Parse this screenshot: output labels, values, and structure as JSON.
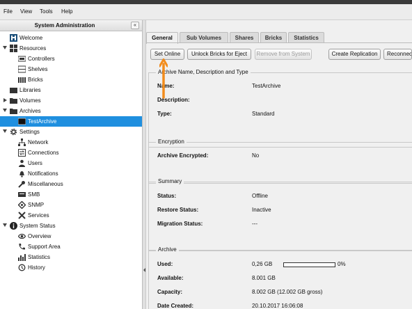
{
  "menubar": {
    "items": [
      "File",
      "View",
      "Tools",
      "Help"
    ]
  },
  "sidebar": {
    "title": "System Administration",
    "collapse_glyph": "«",
    "items": [
      {
        "label": "Welcome",
        "icon": "welcome-icon"
      },
      {
        "label": "Resources",
        "icon": "grid-icon",
        "expanded": true
      },
      {
        "label": "Controllers",
        "icon": "controller-icon"
      },
      {
        "label": "Shelves",
        "icon": "shelf-icon"
      },
      {
        "label": "Bricks",
        "icon": "bricks-icon"
      },
      {
        "label": "Libraries",
        "icon": "library-icon"
      },
      {
        "label": "Volumes",
        "icon": "folder-icon",
        "expanded": false
      },
      {
        "label": "Archives",
        "icon": "folder-icon",
        "expanded": true
      },
      {
        "label": "TestArchive",
        "icon": "archive-icon",
        "selected": true
      },
      {
        "label": "Settings",
        "icon": "gear-icon",
        "expanded": true
      },
      {
        "label": "Network",
        "icon": "network-icon"
      },
      {
        "label": "Connections",
        "icon": "connections-icon"
      },
      {
        "label": "Users",
        "icon": "user-icon"
      },
      {
        "label": "Notifications",
        "icon": "bell-icon"
      },
      {
        "label": "Miscellaneous",
        "icon": "wrench-icon"
      },
      {
        "label": "SMB",
        "icon": "smb-icon"
      },
      {
        "label": "SNMP",
        "icon": "snmp-icon"
      },
      {
        "label": "Services",
        "icon": "tools-icon"
      },
      {
        "label": "System Status",
        "icon": "info-icon",
        "expanded": true
      },
      {
        "label": "Overview",
        "icon": "eye-icon"
      },
      {
        "label": "Support Area",
        "icon": "phone-icon"
      },
      {
        "label": "Statistics",
        "icon": "chart-icon"
      },
      {
        "label": "History",
        "icon": "history-icon"
      }
    ]
  },
  "tabs": [
    "General",
    "Sub Volumes",
    "Shares",
    "Bricks",
    "Statistics"
  ],
  "active_tab": "General",
  "toolbar": {
    "set_online": "Set Online",
    "unlock_bricks": "Unlock Bricks for Eject",
    "remove_from_system": "Remove from System",
    "create_replication": "Create Replication",
    "reconnect": "Reconnect"
  },
  "groups": {
    "name_desc_type": {
      "title": "Archive Name, Description and Type",
      "name_label": "Name:",
      "name_value": "TestArchive",
      "description_label": "Description:",
      "description_value": "",
      "type_label": "Type:",
      "type_value": "Standard"
    },
    "encryption": {
      "title": "Encryption",
      "encrypted_label": "Archive Encrypted:",
      "encrypted_value": "No"
    },
    "summary": {
      "title": "Summary",
      "status_label": "Status:",
      "status_value": "Offline",
      "restore_label": "Restore Status:",
      "restore_value": "Inactive",
      "migration_label": "Migration Status:",
      "migration_value": "---"
    },
    "archive": {
      "title": "Archive",
      "used_label": "Used:",
      "used_value": "0,26 GB",
      "used_percent_text": "0%",
      "used_fraction": 0.0,
      "available_label": "Available:",
      "available_value": "8.001 GB",
      "capacity_label": "Capacity:",
      "capacity_value": "8.002 GB (12.002 GB gross)",
      "created_label": "Date Created:",
      "created_value": "20.10.2017 16:06:08"
    }
  },
  "colors": {
    "selection": "#1f8fdf",
    "annotation_arrow": "#f28c1c"
  }
}
